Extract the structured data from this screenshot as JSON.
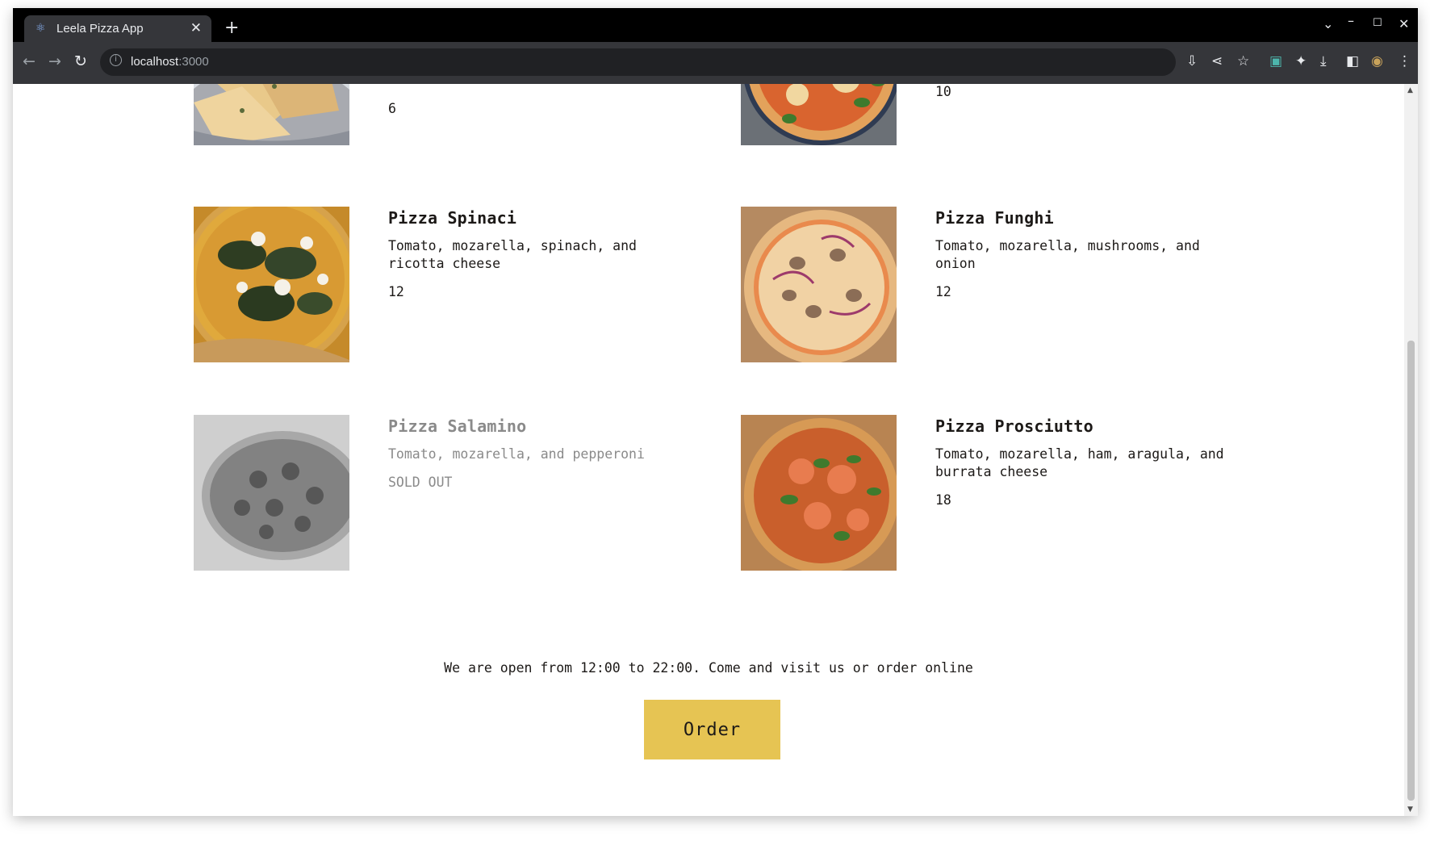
{
  "browser": {
    "tab_title": "Leela Pizza App",
    "url_host": "localhost",
    "url_port": ":3000"
  },
  "pizzas_partial": [
    {
      "price": "6"
    },
    {
      "price": "10"
    }
  ],
  "pizzas": [
    {
      "name": "Pizza Spinaci",
      "ingredients": "Tomato, mozarella, spinach, and ricotta cheese",
      "price": "12",
      "sold_out": false
    },
    {
      "name": "Pizza Funghi",
      "ingredients": "Tomato, mozarella, mushrooms, and onion",
      "price": "12",
      "sold_out": false
    },
    {
      "name": "Pizza Salamino",
      "ingredients": "Tomato, mozarella, and pepperoni",
      "price": "SOLD OUT",
      "sold_out": true
    },
    {
      "name": "Pizza Prosciutto",
      "ingredients": "Tomato, mozarella, ham, aragula, and burrata cheese",
      "price": "18",
      "sold_out": false
    }
  ],
  "footer": {
    "hours_text": "We are open from 12:00 to 22:00. Come and visit us or order online",
    "order_label": "Order"
  },
  "colors": {
    "order_button": "#e6c453",
    "text": "#1c1917",
    "sold_out_text": "#8a8a8a"
  }
}
